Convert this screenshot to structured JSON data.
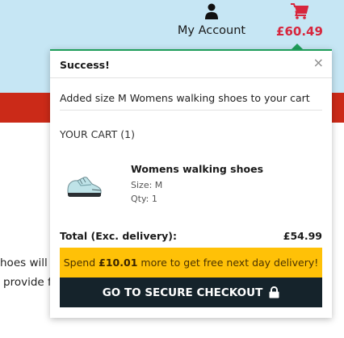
{
  "header": {
    "account_label": "My Account",
    "basket_total": "£60.49",
    "icons": {
      "account": "person-icon",
      "basket": "shopping-cart-icon"
    },
    "colors": {
      "header_bg": "#c6e6f4",
      "band": "#cb2a18",
      "total": "#d7263d"
    }
  },
  "background": {
    "line1": "hoes will s",
    "line2": "provide f"
  },
  "popup": {
    "title": "Success!",
    "close_symbol": "×",
    "message": "Added size M Womens walking shoes to your cart",
    "cart_heading": "YOUR CART (1)",
    "item": {
      "name": "Womens walking shoes",
      "size": "Size: M",
      "qty": "Qty: 1",
      "image": "walking-shoe-image"
    },
    "total_label": "Total (Exc. delivery):",
    "total_value": "£54.99",
    "promo": {
      "prefix": "Spend",
      "amount": "£10.01",
      "suffix": "more to get free next day delivery!"
    },
    "checkout_label": "GO TO SECURE CHECKOUT",
    "colors": {
      "accent": "#1f9e5a",
      "promo_bg": "#ffc107",
      "checkout_bg": "#15232b"
    }
  }
}
